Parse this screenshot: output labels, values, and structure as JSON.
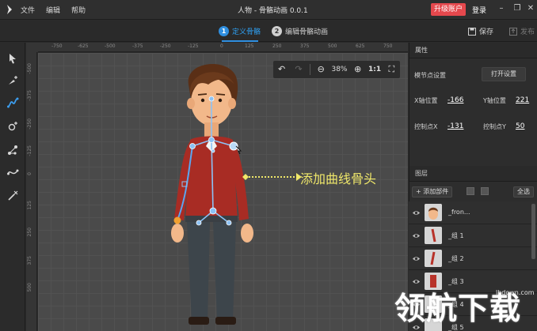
{
  "window": {
    "title": "人物 - 骨骼动画 0.0.1",
    "menu": [
      "文件",
      "编辑",
      "帮助"
    ],
    "upgrade_label": "升级账户",
    "login_label": "登录"
  },
  "steps": [
    {
      "num": "1",
      "label": "定义骨骼"
    },
    {
      "num": "2",
      "label": "编辑骨骼动画"
    }
  ],
  "actions": {
    "save": "保存",
    "publish": "发布"
  },
  "ruler": {
    "top": [
      "-750",
      "-625",
      "-500",
      "-375",
      "-250",
      "-125",
      "0",
      "125",
      "250",
      "375",
      "500",
      "625",
      "750"
    ],
    "left": [
      "-500",
      "-375",
      "-250",
      "-125",
      "0",
      "125",
      "250",
      "375",
      "500"
    ]
  },
  "zoom": {
    "value": "38%",
    "fit_label": "1:1"
  },
  "annotation": "添加曲线骨头",
  "properties": {
    "header": "属性",
    "joint_setting_label": "模节点设置",
    "open_setting_button": "打开设置",
    "x_label": "X轴位置",
    "x_value": "-166",
    "y_label": "Y轴位置",
    "y_value": "221",
    "cx_label": "控制点X",
    "cx_value": "-131",
    "cy_label": "控制点Y",
    "cy_value": "50"
  },
  "layers": {
    "header": "图层",
    "add_part": "+ 添加部件",
    "select_all": "全选",
    "items": [
      {
        "name": "_fron..."
      },
      {
        "name": "_组 1"
      },
      {
        "name": "_组 2"
      },
      {
        "name": "_组 3"
      },
      {
        "name": "_组 4"
      },
      {
        "name": "_组 5"
      }
    ]
  },
  "watermark": {
    "text": "领航下载",
    "url": "lhdown.com"
  },
  "colors": {
    "accent": "#2f8fe0",
    "upgrade": "#e5484d",
    "bone": "#7fb8f0",
    "annotation": "#f0e86a"
  }
}
